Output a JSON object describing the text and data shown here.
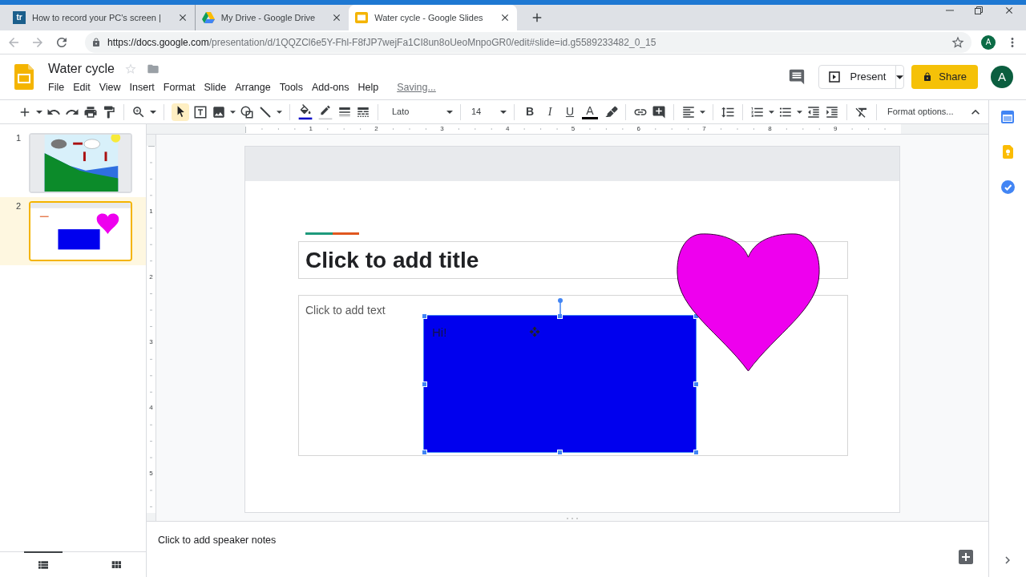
{
  "browser": {
    "tabs": [
      {
        "title": "How to record your PC's screen |",
        "favicon_text": "tr",
        "selected": false
      },
      {
        "title": "My Drive - Google Drive",
        "selected": false
      },
      {
        "title": "Water cycle - Google Slides",
        "selected": true
      }
    ],
    "url_host": "https://docs.google.com",
    "url_path": "/presentation/d/1QQZCl6e5Y-Fhl-F8fJP7wejFa1CI8un8oUeoMnpoGR0/edit#slide=id.g5589233482_0_15",
    "profile_initial": "A"
  },
  "app": {
    "doc_title": "Water cycle",
    "menu": [
      "File",
      "Edit",
      "View",
      "Insert",
      "Format",
      "Slide",
      "Arrange",
      "Tools",
      "Add-ons",
      "Help"
    ],
    "save_status": "Saving...",
    "present_label": "Present",
    "share_label": "Share",
    "avatar_initial": "A"
  },
  "toolbar": {
    "select_tool_selected": true,
    "font": "Lato",
    "font_size": "14",
    "bold": "B",
    "italic": "I",
    "underline": "U",
    "text_color": "A",
    "format_options": "Format options..."
  },
  "ruler": {
    "horizontal": [
      "1",
      "2",
      "3",
      "4",
      "5",
      "6",
      "7",
      "8",
      "9"
    ],
    "vertical": [
      "1",
      "2",
      "3",
      "4",
      "5"
    ]
  },
  "filmstrip": [
    {
      "number": "1",
      "selected": false
    },
    {
      "number": "2",
      "selected": true
    }
  ],
  "slide": {
    "title_placeholder": "Click to add title",
    "body_placeholder": "Click to add text",
    "shapes": [
      {
        "kind": "rectangle",
        "text": "Hi!",
        "color": "#0000ee",
        "selected": true
      },
      {
        "kind": "heart",
        "color": "#ee00ee",
        "selected": false
      }
    ]
  },
  "speaker_notes": {
    "placeholder": "Click to add speaker notes"
  }
}
